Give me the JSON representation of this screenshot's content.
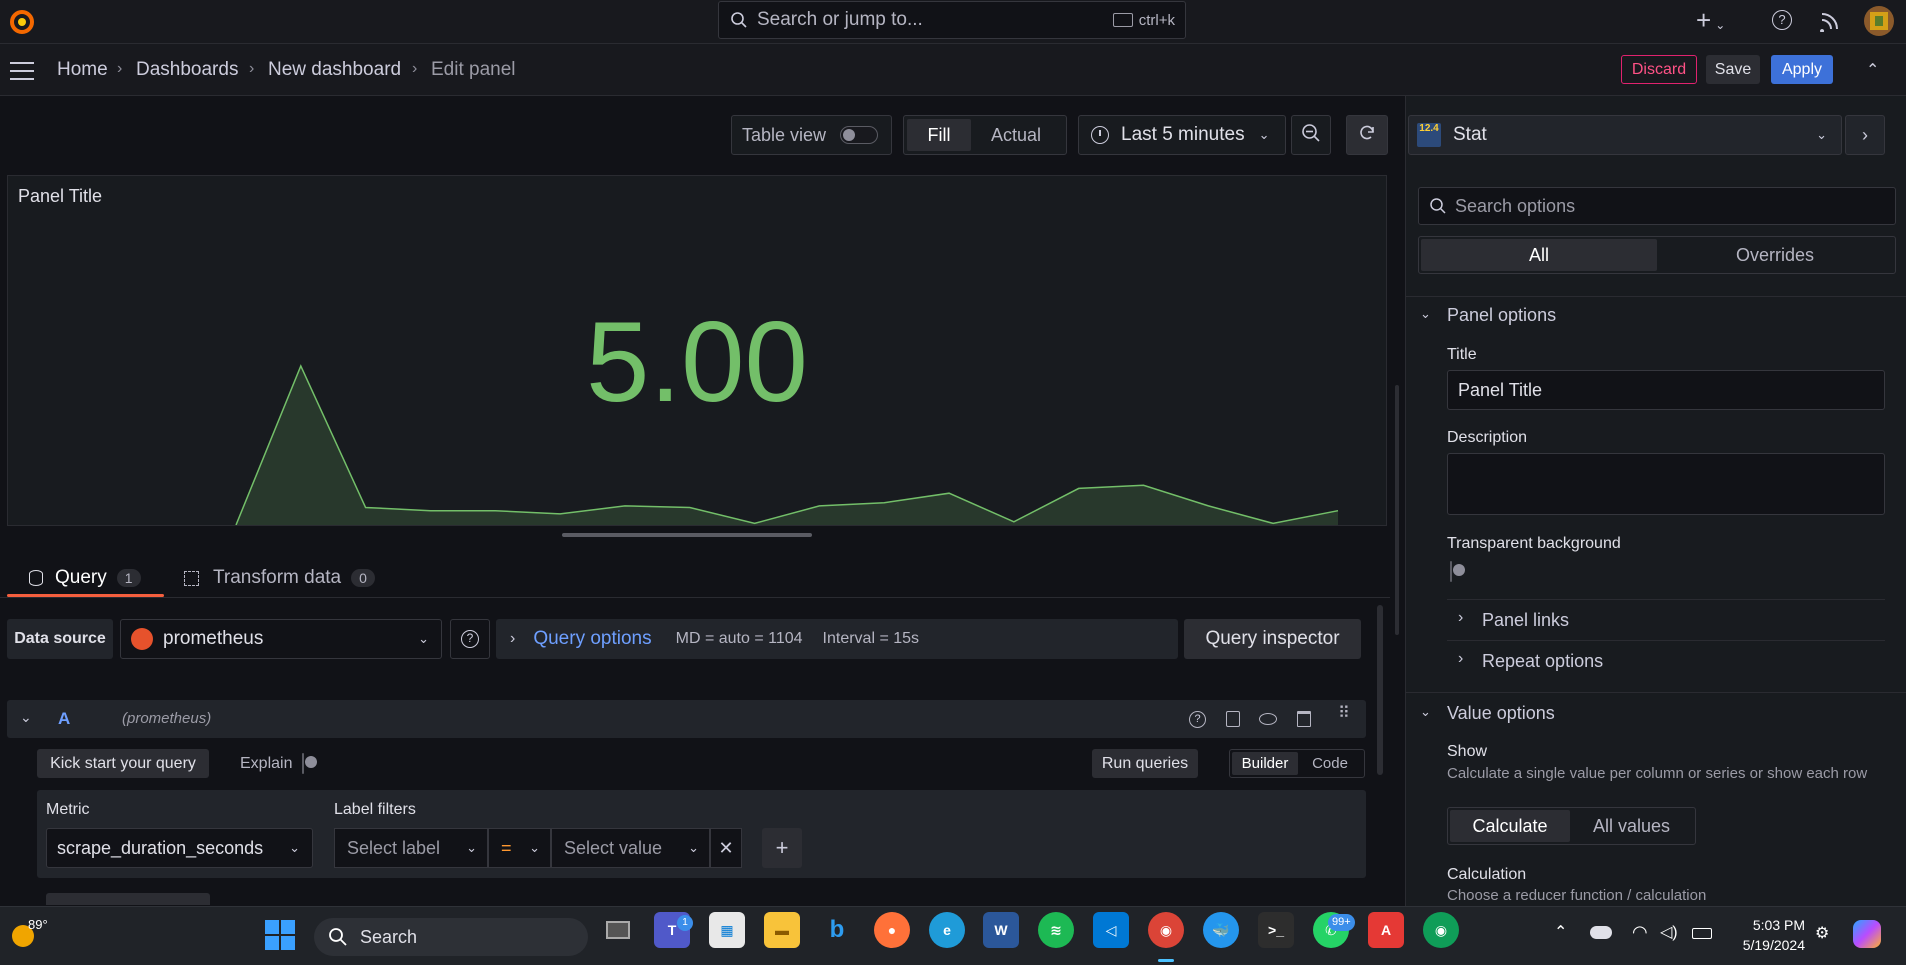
{
  "topbar": {
    "search_placeholder": "Search or jump to...",
    "shortcut": "ctrl+k"
  },
  "breadcrumb": {
    "items": [
      "Home",
      "Dashboards",
      "New dashboard",
      "Edit panel"
    ]
  },
  "actions": {
    "discard": "Discard",
    "save": "Save",
    "apply": "Apply"
  },
  "toolbar": {
    "table_view": "Table view",
    "fill": "Fill",
    "actual": "Actual",
    "time_range": "Last 5 minutes"
  },
  "panel": {
    "title": "Panel Title",
    "value": "5.00",
    "value_color": "#73bf69",
    "sparkline": [
      0.0,
      5.0,
      0.55,
      0.45,
      0.45,
      0.35,
      0.6,
      0.55,
      0.05,
      0.6,
      0.7,
      1.0,
      0.1,
      1.15,
      1.25,
      0.6,
      0.05,
      0.45
    ]
  },
  "tabs": {
    "query_label": "Query",
    "query_count": "1",
    "transform_label": "Transform data",
    "transform_count": "0"
  },
  "datasource": {
    "label": "Data source",
    "value": "prometheus",
    "query_options": "Query options",
    "md": "MD = auto = 1104",
    "interval": "Interval = 15s",
    "inspector": "Query inspector"
  },
  "query": {
    "letter": "A",
    "source": "(prometheus)",
    "kick_start": "Kick start your query",
    "explain": "Explain",
    "run": "Run queries",
    "builder": "Builder",
    "code": "Code",
    "metric_label": "Metric",
    "metric_value": "scrape_duration_seconds",
    "label_filters": "Label filters",
    "select_label": "Select label",
    "operator": "=",
    "select_value": "Select value"
  },
  "viz": {
    "badge": "12.4",
    "name": "Stat",
    "search_placeholder": "Search options",
    "tab_all": "All",
    "tab_overrides": "Overrides"
  },
  "options": {
    "panel_options": "Panel options",
    "title_label": "Title",
    "title_value": "Panel Title",
    "description_label": "Description",
    "transparent_label": "Transparent background",
    "panel_links": "Panel links",
    "repeat_options": "Repeat options",
    "value_options": "Value options",
    "show_label": "Show",
    "show_desc": "Calculate a single value per column or series or show each row",
    "calculate": "Calculate",
    "all_values": "All values",
    "calculation_label": "Calculation",
    "calculation_desc": "Choose a reducer function / calculation"
  },
  "taskbar": {
    "weather": "89°",
    "search": "Search",
    "time": "5:03 PM",
    "date": "5/19/2024",
    "whatsapp_badge": "99+",
    "teams_badge": "1"
  }
}
